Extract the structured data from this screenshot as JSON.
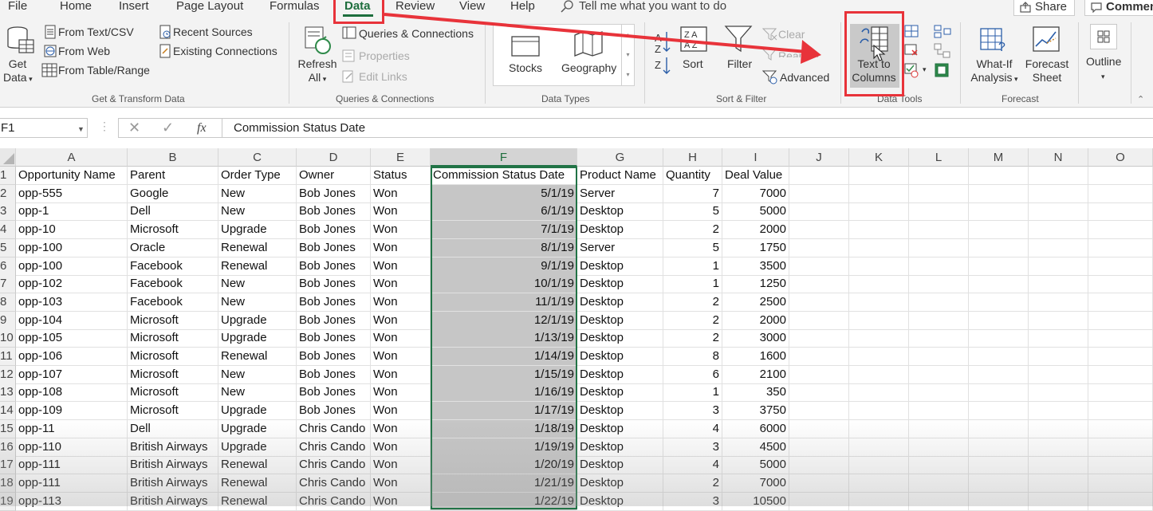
{
  "menu": {
    "tabs": [
      "File",
      "Home",
      "Insert",
      "Page Layout",
      "Formulas",
      "Data",
      "Review",
      "View",
      "Help"
    ],
    "tell_me": "Tell me what you want to do",
    "share": "Share",
    "comments": "Comments"
  },
  "ribbon": {
    "get_transform": {
      "get_data": [
        "Get",
        "Data"
      ],
      "from_text_csv": "From Text/CSV",
      "from_web": "From Web",
      "from_table_range": "From Table/Range",
      "recent_sources": "Recent Sources",
      "existing_connections": "Existing Connections",
      "label": "Get & Transform Data"
    },
    "queries": {
      "refresh_all": [
        "Refresh",
        "All"
      ],
      "queries_connections": "Queries & Connections",
      "properties": "Properties",
      "edit_links": "Edit Links",
      "label": "Queries & Connections"
    },
    "data_types": {
      "stocks": "Stocks",
      "geography": "Geography",
      "label": "Data Types"
    },
    "sort_filter": {
      "sort": "Sort",
      "filter": "Filter",
      "clear": "Clear",
      "reapply": "Reapply",
      "advanced": "Advanced",
      "label": "Sort & Filter"
    },
    "data_tools": {
      "text_to_columns": [
        "Text to",
        "Columns"
      ],
      "label": "Data Tools"
    },
    "forecast": {
      "what_if": [
        "What-If",
        "Analysis"
      ],
      "forecast_sheet": [
        "Forecast",
        "Sheet"
      ],
      "label": "Forecast"
    },
    "outline": {
      "outline": "Outline"
    }
  },
  "formula_bar": {
    "name_box": "F1",
    "fx": "fx",
    "value": "Commission Status Date"
  },
  "sheet": {
    "columns": [
      "A",
      "B",
      "C",
      "D",
      "E",
      "F",
      "G",
      "H",
      "I",
      "J",
      "K",
      "L",
      "M",
      "N",
      "O"
    ],
    "headers": [
      "Opportunity Name",
      "Parent",
      "Order Type",
      "Owner",
      "Status",
      "Commission Status Date",
      "Product Name",
      "Quantity",
      "Deal Value"
    ],
    "rows": [
      [
        "opp-555",
        "Google",
        "New",
        "Bob Jones",
        "Won",
        "5/1/19",
        "Server",
        "7",
        "7000"
      ],
      [
        "opp-1",
        "Dell",
        "New",
        "Bob Jones",
        "Won",
        "6/1/19",
        "Desktop",
        "5",
        "5000"
      ],
      [
        "opp-10",
        "Microsoft",
        "Upgrade",
        "Bob Jones",
        "Won",
        "7/1/19",
        "Desktop",
        "2",
        "2000"
      ],
      [
        "opp-100",
        "Oracle",
        "Renewal",
        "Bob Jones",
        "Won",
        "8/1/19",
        "Server",
        "5",
        "1750"
      ],
      [
        "opp-100",
        "Facebook",
        "Renewal",
        "Bob Jones",
        "Won",
        "9/1/19",
        "Desktop",
        "1",
        "3500"
      ],
      [
        "opp-102",
        "Facebook",
        "New",
        "Bob Jones",
        "Won",
        "10/1/19",
        "Desktop",
        "1",
        "1250"
      ],
      [
        "opp-103",
        "Facebook",
        "New",
        "Bob Jones",
        "Won",
        "11/1/19",
        "Desktop",
        "2",
        "2500"
      ],
      [
        "opp-104",
        "Microsoft",
        "Upgrade",
        "Bob Jones",
        "Won",
        "12/1/19",
        "Desktop",
        "2",
        "2000"
      ],
      [
        "opp-105",
        "Microsoft",
        "Upgrade",
        "Bob Jones",
        "Won",
        "1/13/19",
        "Desktop",
        "2",
        "3000"
      ],
      [
        "opp-106",
        "Microsoft",
        "Renewal",
        "Bob Jones",
        "Won",
        "1/14/19",
        "Desktop",
        "8",
        "1600"
      ],
      [
        "opp-107",
        "Microsoft",
        "New",
        "Bob Jones",
        "Won",
        "1/15/19",
        "Desktop",
        "6",
        "2100"
      ],
      [
        "opp-108",
        "Microsoft",
        "New",
        "Bob Jones",
        "Won",
        "1/16/19",
        "Desktop",
        "1",
        "350"
      ],
      [
        "opp-109",
        "Microsoft",
        "Upgrade",
        "Bob Jones",
        "Won",
        "1/17/19",
        "Desktop",
        "3",
        "3750"
      ],
      [
        "opp-11",
        "Dell",
        "Upgrade",
        "Chris Cando",
        "Won",
        "1/18/19",
        "Desktop",
        "4",
        "6000"
      ],
      [
        "opp-110",
        "British Airways",
        "Upgrade",
        "Chris Cando",
        "Won",
        "1/19/19",
        "Desktop",
        "3",
        "4500"
      ],
      [
        "opp-111",
        "British Airways",
        "Renewal",
        "Chris Cando",
        "Won",
        "1/20/19",
        "Desktop",
        "4",
        "5000"
      ],
      [
        "opp-111",
        "British Airways",
        "Renewal",
        "Chris Cando",
        "Won",
        "1/21/19",
        "Desktop",
        "2",
        "7000"
      ],
      [
        "opp-113",
        "British Airways",
        "Renewal",
        "Chris Cando",
        "Won",
        "1/22/19",
        "Desktop",
        "3",
        "10500"
      ]
    ]
  },
  "colors": {
    "accent": "#217346",
    "annotation": "#e8333a",
    "selection_fill": "#c6c6c6"
  }
}
